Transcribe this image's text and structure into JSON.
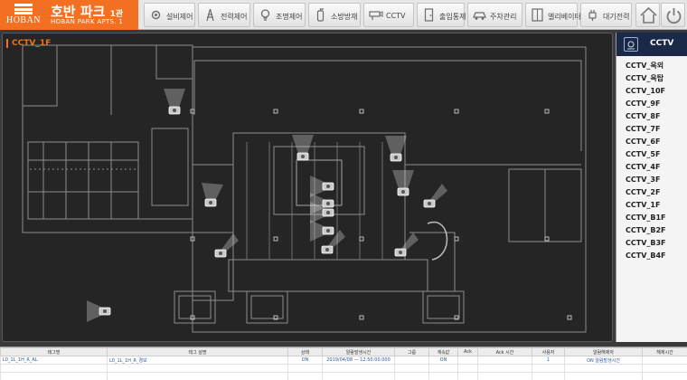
{
  "brand": {
    "logo_text": "HOBAN",
    "title": "호반 파크",
    "title_suffix": "1관",
    "subtitle": "HOBAN PARK APTS. 1"
  },
  "nav": [
    {
      "label": "설비제어",
      "icon": "gear-icon"
    },
    {
      "label": "전력제어",
      "icon": "power-tower-icon"
    },
    {
      "label": "조명제어",
      "icon": "bulb-icon"
    },
    {
      "label": "소방방재",
      "icon": "fire-extinguisher-icon"
    },
    {
      "label": "CCTV",
      "icon": "cctv-icon"
    },
    {
      "label": "출입통제",
      "icon": "door-icon"
    },
    {
      "label": "주차관리",
      "icon": "car-icon"
    },
    {
      "label": "엘리베이터",
      "icon": "elevator-icon"
    },
    {
      "label": "대기전력",
      "icon": "plug-icon"
    }
  ],
  "header_icons": {
    "home": "home-icon",
    "power": "power-icon"
  },
  "panel": {
    "title": "CCTV_1F"
  },
  "sidebar": {
    "title": "CCTV",
    "icon": "cctv-monitor-icon",
    "items": [
      "CCTV_옥외",
      "CCTV_옥탑",
      "CCTV_10F",
      "CCTV_9F",
      "CCTV_8F",
      "CCTV_7F",
      "CCTV_6F",
      "CCTV_5F",
      "CCTV_4F",
      "CCTV_3F",
      "CCTV_2F",
      "CCTV_1F",
      "CCTV_B1F",
      "CCTV_B2F",
      "CCTV_B3F",
      "CCTV_B4F"
    ]
  },
  "cameras": {
    "count": 14,
    "icon": "cctv-camera-icon"
  },
  "colors": {
    "accent": "#f36f21",
    "sidebar_head": "#1a2947",
    "map_bg": "#252525",
    "link_text": "#2c5aa0"
  },
  "table": {
    "headers": [
      "태그명",
      "태그 설명",
      "상태",
      "알람발생시간",
      "그룹",
      "계속값",
      "Ack",
      "Ack 시간",
      "사용자",
      "알람해제자",
      "해제시간"
    ],
    "rows": [
      [
        "L0_1L_1H_R_AL",
        "L0_1L_1H_R_경보",
        "ON",
        "2019/04/08 — 12:50:00.000",
        "",
        "ON",
        "",
        "",
        "1",
        "ON 알람발생시간",
        ""
      ]
    ]
  }
}
